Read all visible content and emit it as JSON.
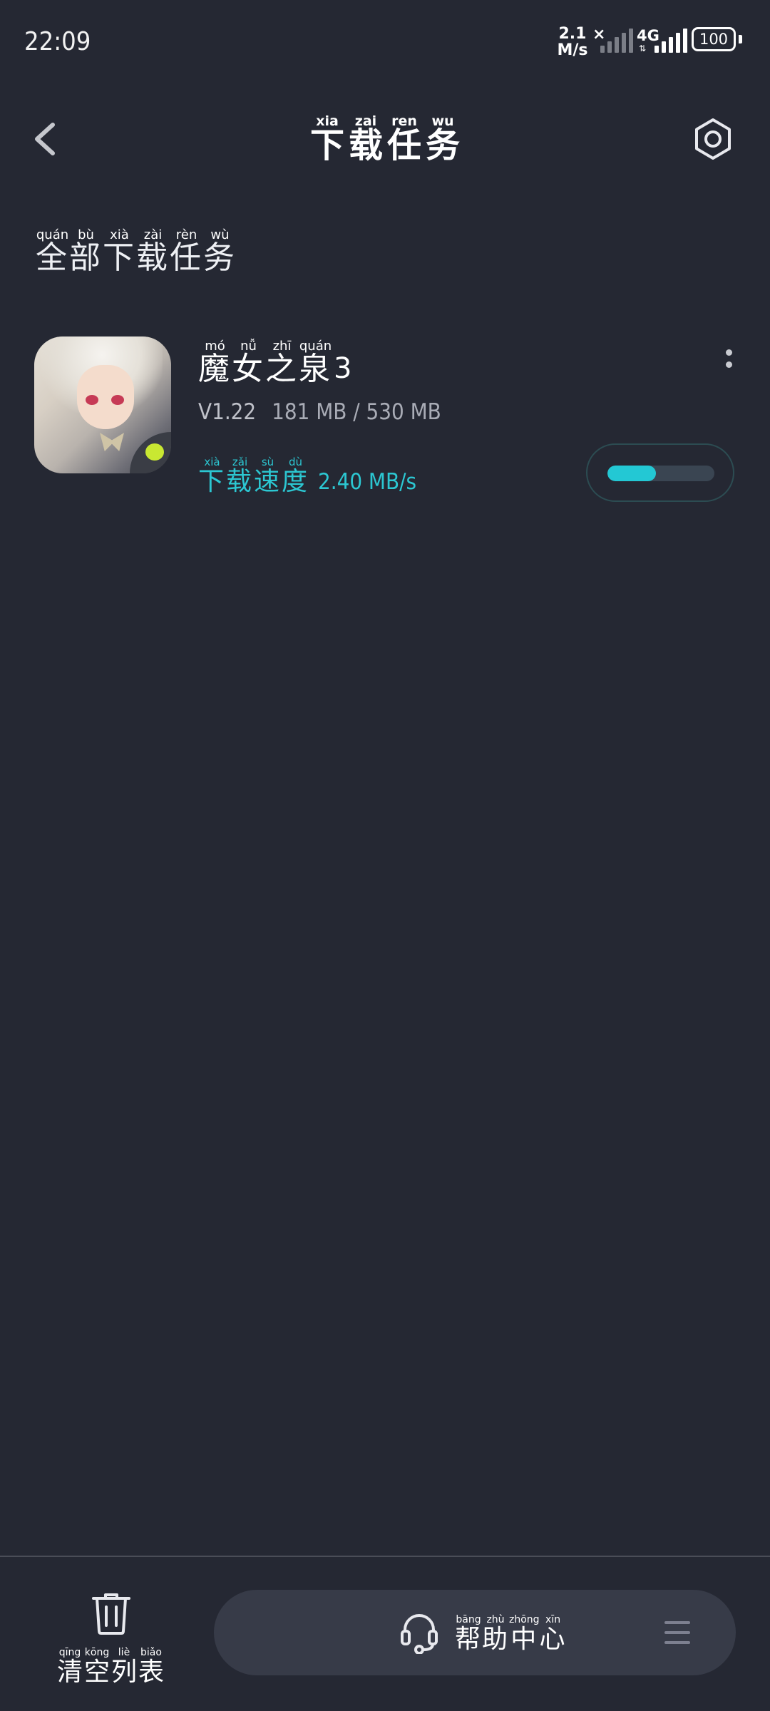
{
  "status_bar": {
    "time": "22:09",
    "net_speed_value": "2.1",
    "net_speed_unit": "M/s",
    "sim_no_service": "×",
    "network_type": "4G",
    "network_arrows": "⇅",
    "battery": "100"
  },
  "header": {
    "title_chars": [
      {
        "hanzi": "下",
        "pinyin": "xia"
      },
      {
        "hanzi": "载",
        "pinyin": "zai"
      },
      {
        "hanzi": "任",
        "pinyin": "ren"
      },
      {
        "hanzi": "务",
        "pinyin": "wu"
      }
    ],
    "back_icon": "chevron-left-icon",
    "settings_icon": "hexagon-settings-icon"
  },
  "section": {
    "title_chars": [
      {
        "hanzi": "全",
        "pinyin": "quán"
      },
      {
        "hanzi": "部",
        "pinyin": "bù"
      },
      {
        "hanzi": "下",
        "pinyin": "xià"
      },
      {
        "hanzi": "载",
        "pinyin": "zài"
      },
      {
        "hanzi": "任",
        "pinyin": "rèn"
      },
      {
        "hanzi": "务",
        "pinyin": "wù"
      }
    ]
  },
  "task": {
    "name_chars": [
      {
        "hanzi": "魔",
        "pinyin": "mó"
      },
      {
        "hanzi": "女",
        "pinyin": "nǚ"
      },
      {
        "hanzi": "之",
        "pinyin": "zhī"
      },
      {
        "hanzi": "泉",
        "pinyin": "quán"
      }
    ],
    "name_suffix": "3",
    "version": "V1.22",
    "size_text": "181 MB / 530 MB",
    "speed_chars": [
      {
        "hanzi": "下",
        "pinyin": "xià"
      },
      {
        "hanzi": "载",
        "pinyin": "zǎi"
      },
      {
        "hanzi": "速",
        "pinyin": "sù"
      },
      {
        "hanzi": "度",
        "pinyin": "dù"
      }
    ],
    "speed_value": "2.40 MB/s",
    "progress": 0.45,
    "accent_color": "#23c8d4"
  },
  "bottom_bar": {
    "clear_chars": [
      {
        "hanzi": "清",
        "pinyin": "qīng"
      },
      {
        "hanzi": "空",
        "pinyin": "kōng"
      },
      {
        "hanzi": "列",
        "pinyin": "liè"
      },
      {
        "hanzi": "表",
        "pinyin": "biǎo"
      }
    ],
    "help_chars": [
      {
        "hanzi": "帮",
        "pinyin": "bāng"
      },
      {
        "hanzi": "助",
        "pinyin": "zhù"
      },
      {
        "hanzi": "中",
        "pinyin": "zhōng"
      },
      {
        "hanzi": "心",
        "pinyin": "xīn"
      }
    ]
  },
  "colors": {
    "background": "#252833",
    "pill": "#373b48",
    "accent": "#23c8d4"
  }
}
